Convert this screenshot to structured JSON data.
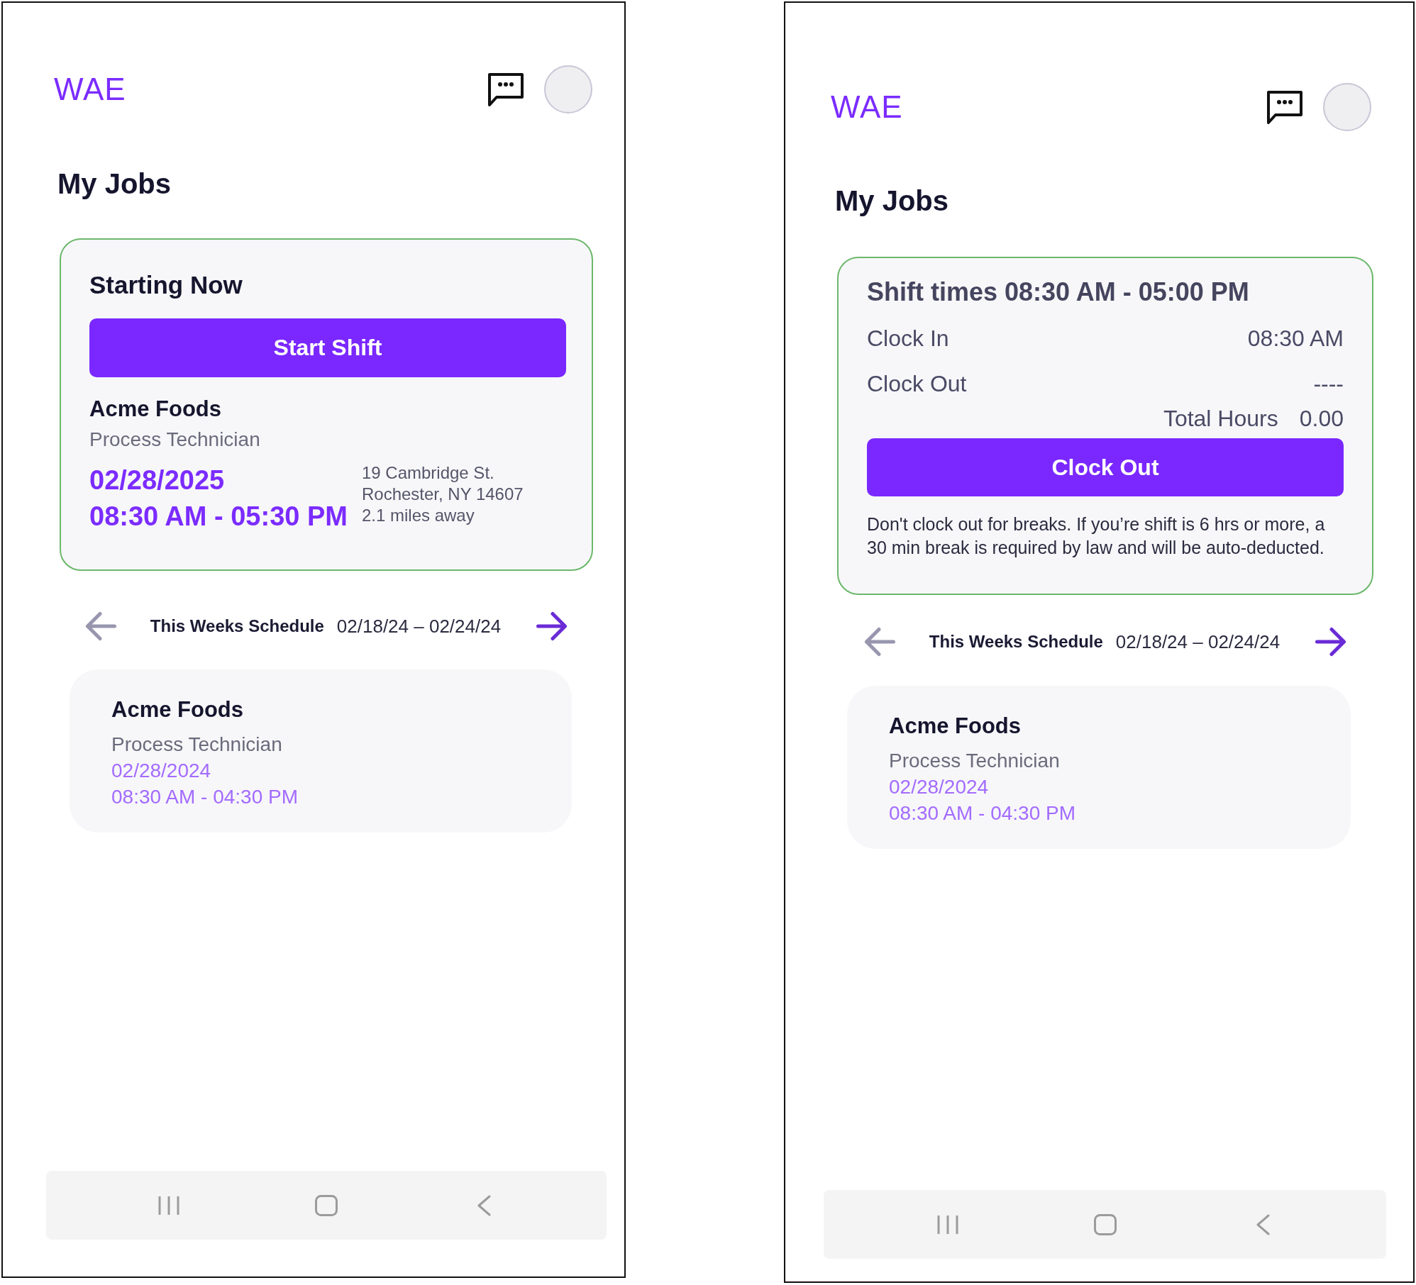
{
  "screens": [
    {
      "header": {
        "logo": "WAE"
      },
      "title": "My Jobs",
      "shift_card": {
        "kind": "upcoming",
        "heading": "Starting Now",
        "button": "Start Shift",
        "company": "Acme Foods",
        "role": "Process Technician",
        "date": "02/28/2025",
        "time": "08:30 AM - 05:30 PM",
        "address": [
          "19 Cambridge St.",
          "Rochester, NY 14607"
        ],
        "distance": "2.1 miles away"
      },
      "schedule": {
        "label": "This Weeks Schedule",
        "range": "02/18/24 – 02/24/24",
        "prev_disabled": true,
        "next_disabled": false,
        "jobs": [
          {
            "company": "Acme Foods",
            "role": "Process Technician",
            "date": "02/28/2024",
            "time": "08:30 AM - 04:30 PM"
          }
        ]
      }
    },
    {
      "header": {
        "logo": "WAE"
      },
      "title": "My Jobs",
      "shift_card": {
        "kind": "active",
        "heading": "Shift times 08:30 AM - 05:00 PM",
        "entries": [
          {
            "label": "Clock In",
            "value": "08:30 AM"
          },
          {
            "label": "Clock Out",
            "value": "----"
          }
        ],
        "total": {
          "label": "Total Hours",
          "value": "0.00"
        },
        "button": "Clock Out",
        "note": "Don't clock out for breaks. If you’re shift is 6 hrs or more, a 30 min break is required by law and will be auto-deducted."
      },
      "schedule": {
        "label": "This Weeks Schedule",
        "range": "02/18/24 – 02/24/24",
        "prev_disabled": true,
        "next_disabled": false,
        "jobs": [
          {
            "company": "Acme Foods",
            "role": "Process Technician",
            "date": "02/28/2024",
            "time": "08:30 AM - 04:30 PM"
          }
        ]
      }
    }
  ]
}
